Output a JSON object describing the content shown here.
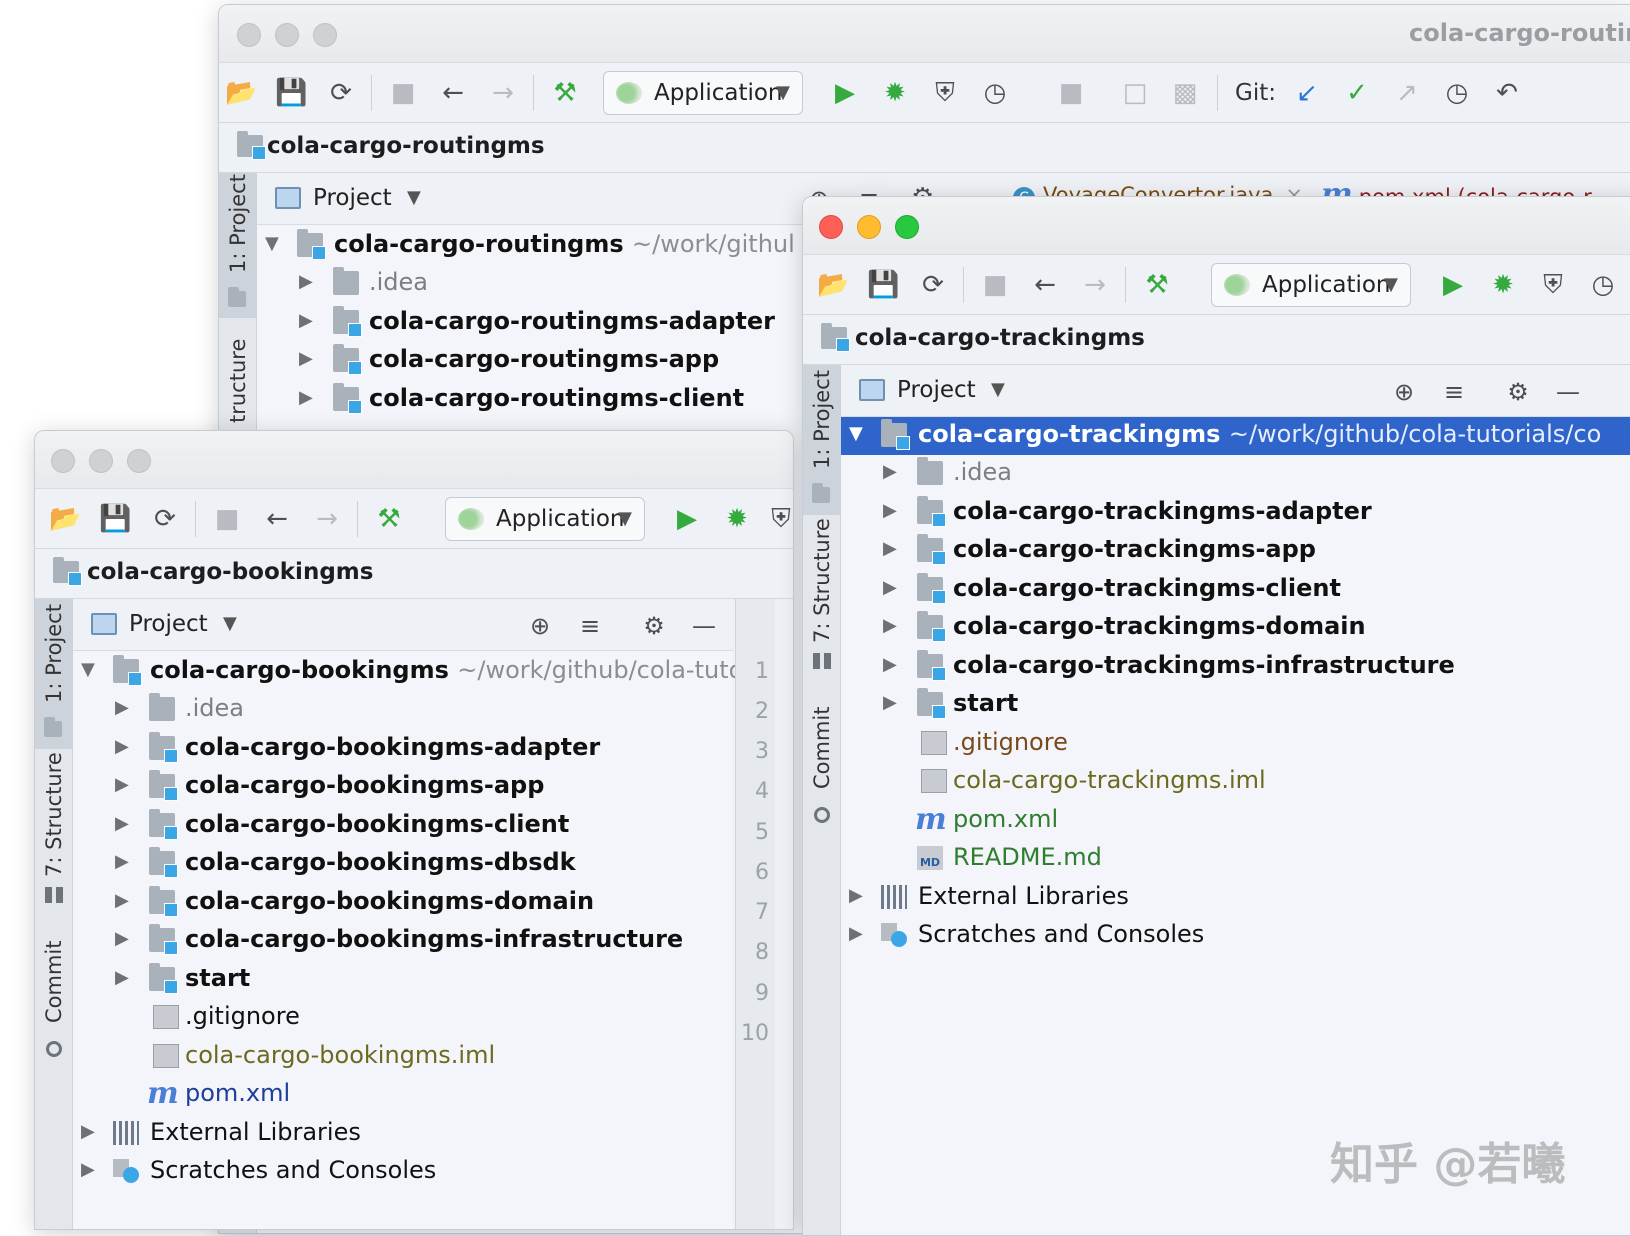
{
  "windows": {
    "routing": {
      "title": "cola-cargo-routir",
      "run_config": "Application",
      "git_label": "Git:",
      "nav": "cola-cargo-routingms",
      "project_label": "Project",
      "stripe": {
        "project": "1: Project",
        "structure": "tructure"
      },
      "editor_tabs": [
        "VoyageConvertor.java",
        "pom.xml (cola-cargo-r"
      ],
      "tree": [
        {
          "label": "cola-cargo-routingms",
          "path": "~/work/githul"
        },
        {
          "label": ".idea"
        },
        {
          "label": "cola-cargo-routingms-adapter"
        },
        {
          "label": "cola-cargo-routingms-app"
        },
        {
          "label": "cola-cargo-routingms-client"
        }
      ]
    },
    "booking": {
      "run_config": "Application",
      "nav": "cola-cargo-bookingms",
      "project_label": "Project",
      "stripe": {
        "project": "1: Project",
        "structure": "7: Structure",
        "commit": "Commit"
      },
      "line_numbers": [
        "1",
        "2",
        "3",
        "4",
        "5",
        "6",
        "7",
        "8",
        "9",
        "10"
      ],
      "tree": [
        {
          "label": "cola-cargo-bookingms",
          "path": "~/work/github/cola-tuto"
        },
        {
          "label": ".idea"
        },
        {
          "label": "cola-cargo-bookingms-adapter"
        },
        {
          "label": "cola-cargo-bookingms-app"
        },
        {
          "label": "cola-cargo-bookingms-client"
        },
        {
          "label": "cola-cargo-bookingms-dbsdk"
        },
        {
          "label": "cola-cargo-bookingms-domain"
        },
        {
          "label": "cola-cargo-bookingms-infrastructure"
        },
        {
          "label": "start"
        },
        {
          "label": ".gitignore"
        },
        {
          "label": "cola-cargo-bookingms.iml"
        },
        {
          "label": "pom.xml"
        },
        {
          "label": "External Libraries"
        },
        {
          "label": "Scratches and Consoles"
        }
      ]
    },
    "tracking": {
      "run_config": "Application",
      "nav": "cola-cargo-trackingms",
      "project_label": "Project",
      "stripe": {
        "project": "1: Project",
        "structure": "7: Structure",
        "commit": "Commit"
      },
      "tree": [
        {
          "label": "cola-cargo-trackingms",
          "path": "~/work/github/cola-tutorials/co"
        },
        {
          "label": ".idea"
        },
        {
          "label": "cola-cargo-trackingms-adapter"
        },
        {
          "label": "cola-cargo-trackingms-app"
        },
        {
          "label": "cola-cargo-trackingms-client"
        },
        {
          "label": "cola-cargo-trackingms-domain"
        },
        {
          "label": "cola-cargo-trackingms-infrastructure"
        },
        {
          "label": "start"
        },
        {
          "label": ".gitignore"
        },
        {
          "label": "cola-cargo-trackingms.iml"
        },
        {
          "label": "pom.xml"
        },
        {
          "label": "README.md"
        },
        {
          "label": "External Libraries"
        },
        {
          "label": "Scratches and Consoles"
        }
      ]
    }
  },
  "icons": {
    "maven": "m",
    "markdown": "MD"
  },
  "watermark": "知乎 @若曦",
  "colors": {
    "selection": "#2f65ca",
    "run": "#36a93f",
    "accent": "#3ba6e6"
  }
}
